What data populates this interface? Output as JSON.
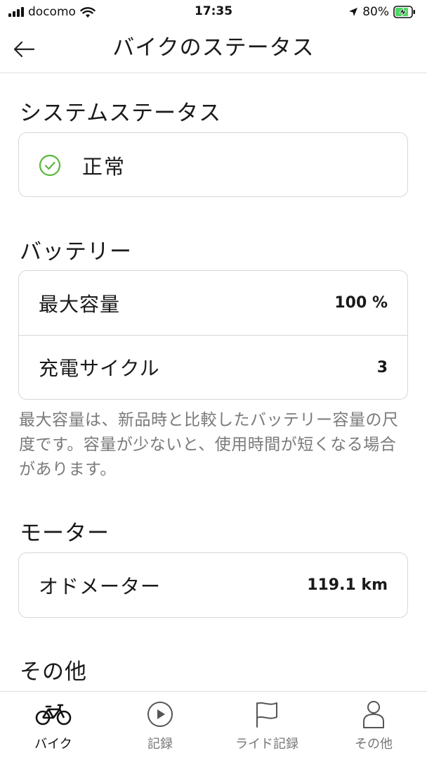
{
  "status_bar": {
    "carrier": "docomo",
    "time": "17:35",
    "battery_percent": "80%"
  },
  "nav": {
    "title": "バイクのステータス"
  },
  "system_status": {
    "title": "システムステータス",
    "status": "正常",
    "status_color": "#5ab83c"
  },
  "battery": {
    "title": "バッテリー",
    "rows": [
      {
        "label": "最大容量",
        "value": "100 %"
      },
      {
        "label": "充電サイクル",
        "value": "3"
      }
    ],
    "note": "最大容量は、新品時と比較したバッテリー容量の尺度です。容量が少ないと、使用時間が短くなる場合があります。"
  },
  "motor": {
    "title": "モーター",
    "rows": [
      {
        "label": "オドメーター",
        "value": "119.1 km"
      }
    ]
  },
  "other": {
    "title": "その他"
  },
  "tab_bar": {
    "tabs": [
      {
        "label": "バイク",
        "icon": "bike-icon",
        "active": true
      },
      {
        "label": "記録",
        "icon": "play-circle-icon",
        "active": false
      },
      {
        "label": "ライド記録",
        "icon": "flag-icon",
        "active": false
      },
      {
        "label": "その他",
        "icon": "person-icon",
        "active": false
      }
    ]
  }
}
